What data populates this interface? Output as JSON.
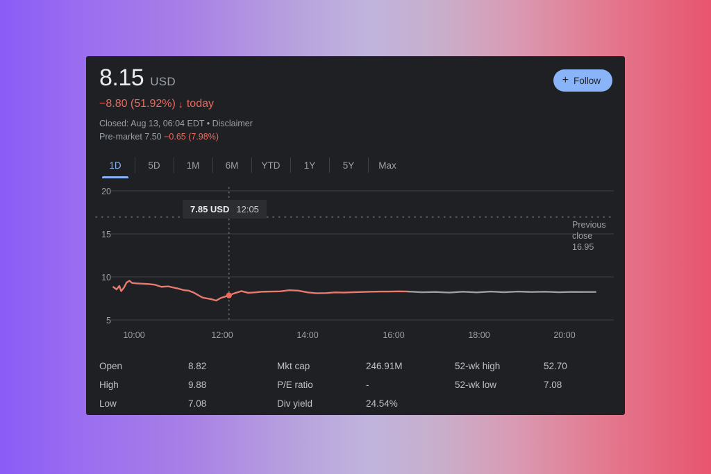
{
  "background": {
    "gradient_from": "#8b5cf6",
    "gradient_mid": "#c0b4dd",
    "gradient_to": "#e8546e"
  },
  "quote": {
    "price": "8.15",
    "currency": "USD",
    "change": "−8.80 (51.92%)",
    "change_arrow": "↓",
    "change_period": "today",
    "status_line": "Closed: Aug 13, 06:04 EDT • Disclaimer",
    "premarket_label": "Pre-market 7.50",
    "premarket_change": "−0.65 (7.98%)",
    "negative_color": "#ea6a5e"
  },
  "follow": {
    "label": "Follow",
    "icon": "plus-icon",
    "plus": "+",
    "accent": "#8ab4f8"
  },
  "range_tabs": [
    {
      "label": "1D",
      "active": true
    },
    {
      "label": "5D",
      "active": false
    },
    {
      "label": "1M",
      "active": false
    },
    {
      "label": "6M",
      "active": false
    },
    {
      "label": "YTD",
      "active": false
    },
    {
      "label": "1Y",
      "active": false
    },
    {
      "label": "5Y",
      "active": false
    },
    {
      "label": "Max",
      "active": false
    }
  ],
  "chart_annotations": {
    "tooltip_price": "7.85 USD",
    "tooltip_time": "12:05",
    "previous_close_line1": "Previous",
    "previous_close_line2": "close",
    "previous_close_value": "16.95"
  },
  "chart_data": {
    "type": "line",
    "title": "",
    "xlabel": "",
    "ylabel": "",
    "ylim": [
      5,
      20
    ],
    "yticks": [
      "20",
      "15",
      "10",
      "5"
    ],
    "ytick_values": [
      20,
      15,
      10,
      5
    ],
    "xticks": [
      "10:00",
      "12:00",
      "14:00",
      "16:00",
      "18:00",
      "20:00"
    ],
    "xtick_values": [
      10,
      12,
      14,
      16,
      18,
      20
    ],
    "xlim": [
      9.5,
      20.5
    ],
    "grid": true,
    "legend": null,
    "reference_line": {
      "label": "Previous close",
      "value": 16.95,
      "style": "dotted",
      "color": "#9aa0a6"
    },
    "crosshair": {
      "x_time": "12:05",
      "y_value": 7.85,
      "style": "dotted"
    },
    "marker": {
      "x_time": "12:05",
      "y_value": 7.85,
      "color": "#ea6a5e"
    },
    "series": [
      {
        "name": "Regular hours",
        "color": "#ea7a70",
        "x": [
          9.55,
          9.62,
          9.68,
          9.72,
          9.78,
          9.84,
          9.9,
          9.96,
          10.05,
          10.15,
          10.3,
          10.45,
          10.6,
          10.75,
          10.9,
          11.0,
          11.1,
          11.2,
          11.3,
          11.4,
          11.5,
          11.6,
          11.7,
          11.8,
          11.9,
          12.0,
          12.08,
          12.2,
          12.35,
          12.5,
          12.65,
          12.8,
          13.0,
          13.2,
          13.4,
          13.6,
          13.8,
          14.0,
          14.2,
          14.4,
          14.6,
          14.8,
          15.0,
          15.2,
          15.4,
          15.6,
          15.8,
          16.0
        ],
        "y": [
          8.82,
          8.55,
          8.95,
          8.35,
          8.75,
          9.35,
          9.55,
          9.3,
          9.25,
          9.22,
          9.18,
          9.1,
          8.85,
          8.9,
          8.72,
          8.6,
          8.45,
          8.4,
          8.2,
          7.9,
          7.6,
          7.5,
          7.4,
          7.25,
          7.55,
          7.72,
          7.85,
          8.1,
          8.35,
          8.15,
          8.2,
          8.28,
          8.3,
          8.32,
          8.45,
          8.4,
          8.2,
          8.1,
          8.12,
          8.2,
          8.18,
          8.22,
          8.25,
          8.28,
          8.3,
          8.3,
          8.32,
          8.3
        ]
      },
      {
        "name": "After hours",
        "color": "#9aa0a6",
        "x": [
          16.0,
          16.3,
          16.6,
          16.9,
          17.2,
          17.5,
          17.8,
          18.1,
          18.4,
          18.7,
          19.0,
          19.3,
          19.6,
          19.9,
          20.1
        ],
        "y": [
          8.3,
          8.22,
          8.25,
          8.18,
          8.28,
          8.2,
          8.3,
          8.22,
          8.3,
          8.25,
          8.28,
          8.22,
          8.26,
          8.25,
          8.25
        ]
      }
    ]
  },
  "stats": {
    "rows": [
      [
        {
          "label": "Open",
          "value": "8.82"
        },
        {
          "label": "Mkt cap",
          "value": "246.91M"
        },
        {
          "label": "52-wk high",
          "value": "52.70"
        }
      ],
      [
        {
          "label": "High",
          "value": "9.88"
        },
        {
          "label": "P/E ratio",
          "value": "-"
        },
        {
          "label": "52-wk low",
          "value": "7.08"
        }
      ],
      [
        {
          "label": "Low",
          "value": "7.08"
        },
        {
          "label": "Div yield",
          "value": "24.54%"
        },
        {
          "label": "",
          "value": ""
        }
      ]
    ]
  }
}
